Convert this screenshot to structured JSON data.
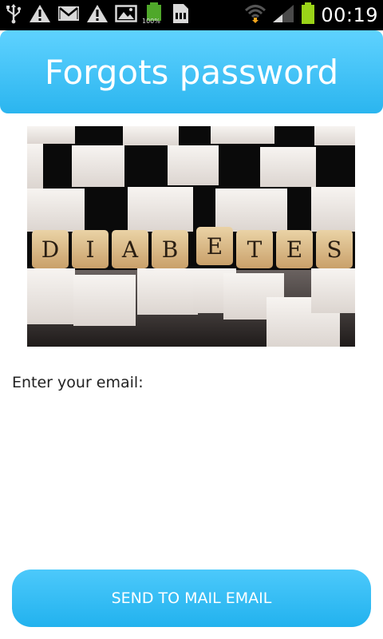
{
  "status_bar": {
    "time": "00:19",
    "battery_percent_label": "100%",
    "icons_left": [
      "usb-icon",
      "warning-icon",
      "gmail-icon",
      "warning-icon",
      "gallery-icon",
      "battery-full-icon",
      "sd-card-icon"
    ],
    "icons_right": [
      "wifi-icon",
      "signal-icon",
      "battery-icon"
    ],
    "battery_level": 1.0
  },
  "header": {
    "title": "Forgots password",
    "color": "#2bb5ef"
  },
  "hero_image": {
    "letters": [
      "D",
      "I",
      "A",
      "B",
      "E",
      "T",
      "E",
      "S"
    ]
  },
  "form": {
    "email_label": "Enter your email:"
  },
  "actions": {
    "send_label": "SEND TO MAIL EMAIL",
    "button_color": "#22b2ee"
  }
}
